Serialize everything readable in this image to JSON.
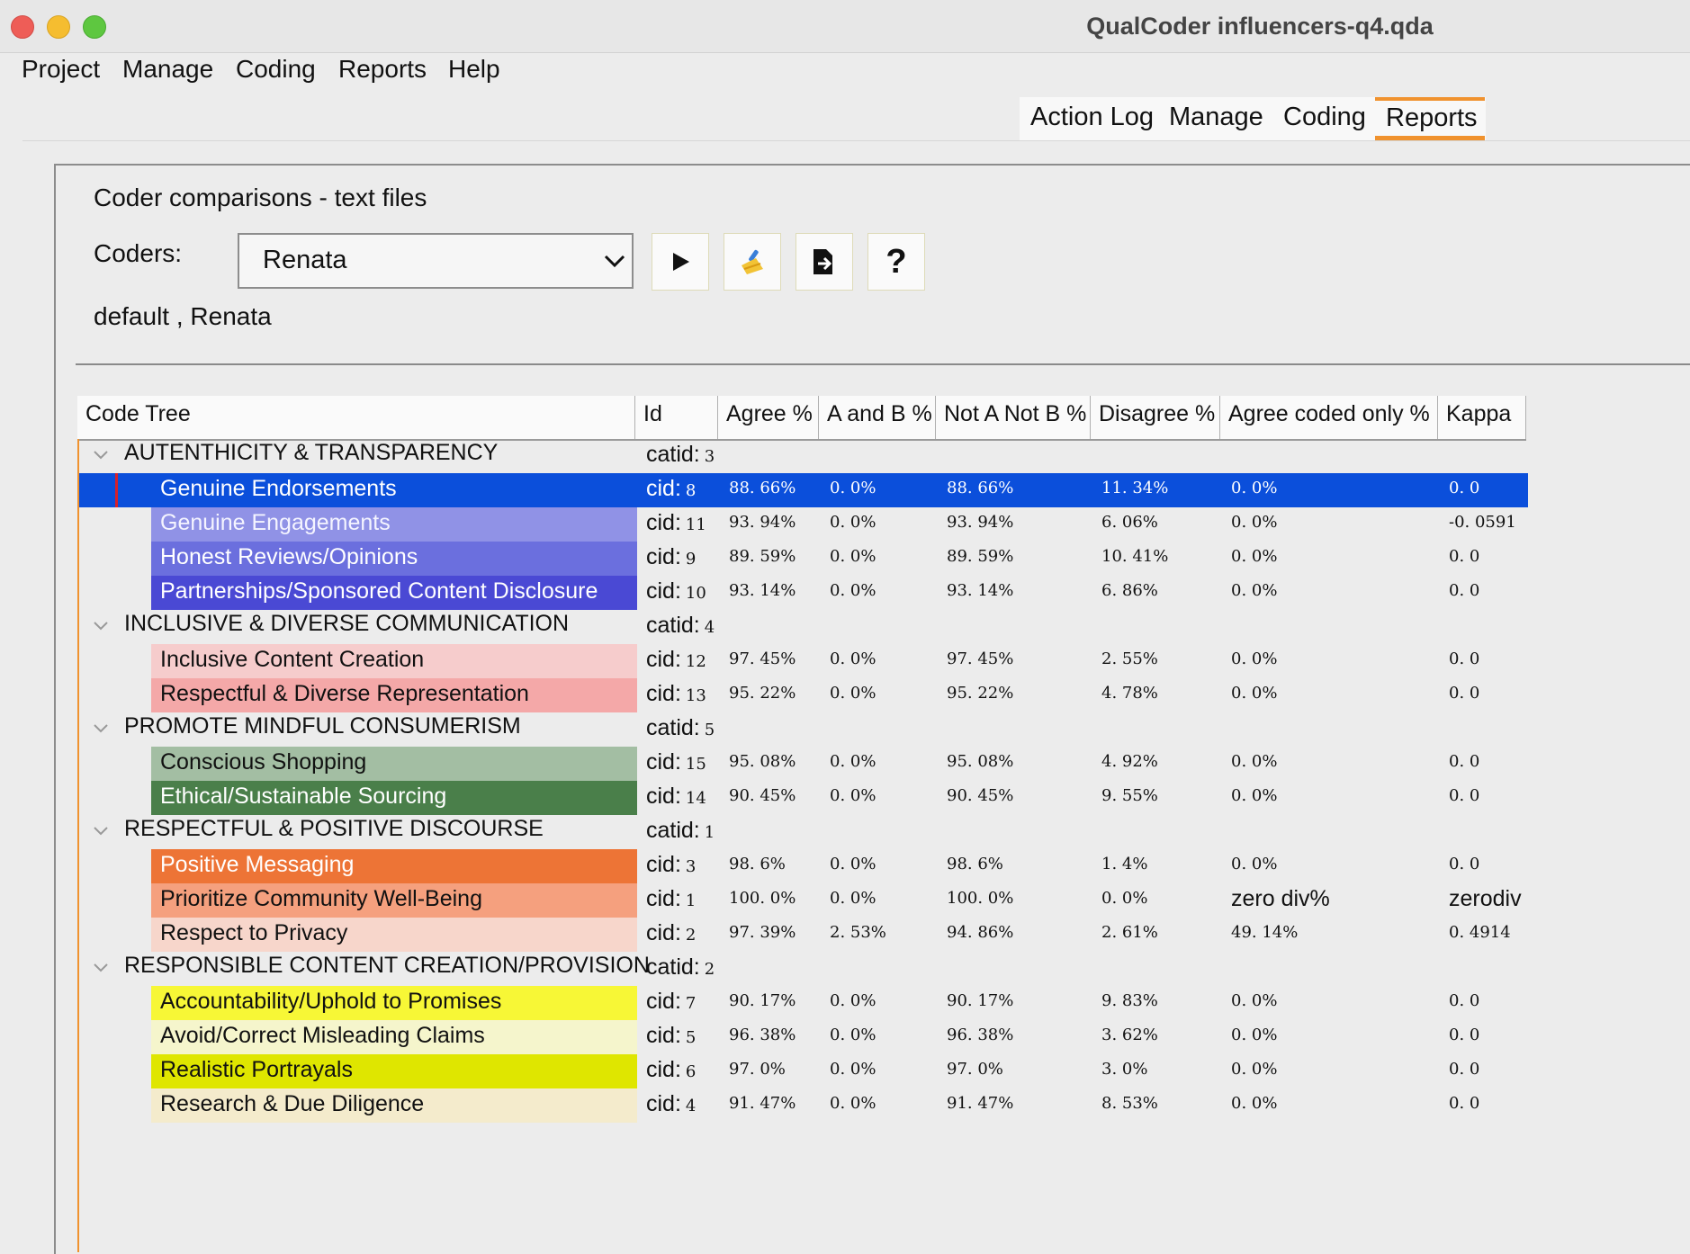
{
  "window": {
    "title": "QualCoder influencers-q4.qda"
  },
  "menubar": [
    "Project",
    "Manage",
    "Coding",
    "Reports",
    "Help"
  ],
  "tabs": [
    {
      "label": "Action Log",
      "active": false
    },
    {
      "label": "Manage",
      "active": false
    },
    {
      "label": "Coding",
      "active": false
    },
    {
      "label": "Reports",
      "active": true
    }
  ],
  "panel": {
    "title": "Coder comparisons - text files",
    "coders_label": "Coders:",
    "coder_selected": "Renata",
    "coders_list": "default , Renata",
    "toolbar_icons": [
      "run-icon",
      "clear-icon",
      "export-icon",
      "help-icon"
    ],
    "help_glyph": "?"
  },
  "table": {
    "headers": [
      "Code Tree",
      "Id",
      "Agree %",
      "A and B %",
      "Not A Not B %",
      "Disagree %",
      "Agree coded only %",
      "Kappa"
    ],
    "rows": [
      {
        "type": "category",
        "name": "AUTENTHICITY & TRANSPARENCY",
        "id_label": "catid:",
        "id": "3"
      },
      {
        "type": "code",
        "name": "Genuine Endorsements",
        "id_label": "cid:",
        "id": "8",
        "agree": "88. 66%",
        "ab": "0. 0%",
        "notab": "88. 66%",
        "disagree": "11. 34%",
        "agree_coded": "0. 0%",
        "kappa": "0. 0",
        "color": "#5861d4",
        "text_color": "#ffffff",
        "selected": true
      },
      {
        "type": "code",
        "name": "Genuine Engagements",
        "id_label": "cid:",
        "id": "11",
        "agree": "93. 94%",
        "ab": "0. 0%",
        "notab": "93. 94%",
        "disagree": "6. 06%",
        "agree_coded": "0. 0%",
        "kappa": "-0. 0591",
        "color": "#9092e6",
        "text_color": "#f4f4ff"
      },
      {
        "type": "code",
        "name": "Honest Reviews/Opinions",
        "id_label": "cid:",
        "id": "9",
        "agree": "89. 59%",
        "ab": "0. 0%",
        "notab": "89. 59%",
        "disagree": "10. 41%",
        "agree_coded": "0. 0%",
        "kappa": "0. 0",
        "color": "#6b6fde",
        "text_color": "#ffffff"
      },
      {
        "type": "code",
        "name": "Partnerships/Sponsored Content Disclosure",
        "id_label": "cid:",
        "id": "10",
        "agree": "93. 14%",
        "ab": "0. 0%",
        "notab": "93. 14%",
        "disagree": "6. 86%",
        "agree_coded": "0. 0%",
        "kappa": "0. 0",
        "color": "#4a49d4",
        "text_color": "#ffffff"
      },
      {
        "type": "category",
        "name": "INCLUSIVE & DIVERSE COMMUNICATION",
        "id_label": "catid:",
        "id": "4"
      },
      {
        "type": "code",
        "name": "Inclusive Content Creation",
        "id_label": "cid:",
        "id": "12",
        "agree": "97. 45%",
        "ab": "0. 0%",
        "notab": "97. 45%",
        "disagree": "2. 55%",
        "agree_coded": "0. 0%",
        "kappa": "0. 0",
        "color": "#f6cccc",
        "text_color": "#111111"
      },
      {
        "type": "code",
        "name": "Respectful & Diverse Representation",
        "id_label": "cid:",
        "id": "13",
        "agree": "95. 22%",
        "ab": "0. 0%",
        "notab": "95. 22%",
        "disagree": "4. 78%",
        "agree_coded": "0. 0%",
        "kappa": "0. 0",
        "color": "#f4a8a8",
        "text_color": "#111111"
      },
      {
        "type": "category",
        "name": "PROMOTE MINDFUL CONSUMERISM",
        "id_label": "catid:",
        "id": "5"
      },
      {
        "type": "code",
        "name": "Conscious Shopping",
        "id_label": "cid:",
        "id": "15",
        "agree": "95. 08%",
        "ab": "0. 0%",
        "notab": "95. 08%",
        "disagree": "4. 92%",
        "agree_coded": "0. 0%",
        "kappa": "0. 0",
        "color": "#a3bea3",
        "text_color": "#111111"
      },
      {
        "type": "code",
        "name": "Ethical/Sustainable Sourcing",
        "id_label": "cid:",
        "id": "14",
        "agree": "90. 45%",
        "ab": "0. 0%",
        "notab": "90. 45%",
        "disagree": "9. 55%",
        "agree_coded": "0. 0%",
        "kappa": "0. 0",
        "color": "#4a7f4a",
        "text_color": "#ffffff"
      },
      {
        "type": "category",
        "name": "RESPECTFUL & POSITIVE DISCOURSE",
        "id_label": "catid:",
        "id": "1"
      },
      {
        "type": "code",
        "name": "Positive Messaging",
        "id_label": "cid:",
        "id": "3",
        "agree": "98. 6%",
        "ab": "0. 0%",
        "notab": "98. 6%",
        "disagree": "1. 4%",
        "agree_coded": "0. 0%",
        "kappa": "0. 0",
        "color": "#ed7436",
        "text_color": "#ffffff"
      },
      {
        "type": "code",
        "name": "Prioritize Community Well-Being",
        "id_label": "cid:",
        "id": "1",
        "agree": "100. 0%",
        "ab": "0. 0%",
        "notab": "100. 0%",
        "disagree": "0. 0%",
        "agree_coded": "zero div%",
        "kappa": "zerodiv",
        "color": "#f5a07e",
        "text_color": "#111111"
      },
      {
        "type": "code",
        "name": "Respect to Privacy",
        "id_label": "cid:",
        "id": "2",
        "agree": "97. 39%",
        "ab": "2. 53%",
        "notab": "94. 86%",
        "disagree": "2. 61%",
        "agree_coded": "49. 14%",
        "kappa": "0. 4914",
        "color": "#f7d6cb",
        "text_color": "#111111"
      },
      {
        "type": "category",
        "name": "RESPONSIBLE CONTENT CREATION/PROVISION",
        "id_label": "catid:",
        "id": "2"
      },
      {
        "type": "code",
        "name": "Accountability/Uphold to Promises",
        "id_label": "cid:",
        "id": "7",
        "agree": "90. 17%",
        "ab": "0. 0%",
        "notab": "90. 17%",
        "disagree": "9. 83%",
        "agree_coded": "0. 0%",
        "kappa": "0. 0",
        "color": "#f7f736",
        "text_color": "#111111"
      },
      {
        "type": "code",
        "name": "Avoid/Correct Misleading Claims",
        "id_label": "cid:",
        "id": "5",
        "agree": "96. 38%",
        "ab": "0. 0%",
        "notab": "96. 38%",
        "disagree": "3. 62%",
        "agree_coded": "0. 0%",
        "kappa": "0. 0",
        "color": "#f5f5cc",
        "text_color": "#111111"
      },
      {
        "type": "code",
        "name": "Realistic Portrayals",
        "id_label": "cid:",
        "id": "6",
        "agree": "97. 0%",
        "ab": "0. 0%",
        "notab": "97. 0%",
        "disagree": "3. 0%",
        "agree_coded": "0. 0%",
        "kappa": "0. 0",
        "color": "#dfe600",
        "text_color": "#111111"
      },
      {
        "type": "code",
        "name": "Research & Due Diligence",
        "id_label": "cid:",
        "id": "4",
        "agree": "91. 47%",
        "ab": "0. 0%",
        "notab": "91. 47%",
        "disagree": "8. 53%",
        "agree_coded": "0. 0%",
        "kappa": "0. 0",
        "color": "#f4ebcc",
        "text_color": "#111111"
      }
    ]
  },
  "colors": {
    "accent": "#f0922e",
    "selection": "#0b4fdb"
  }
}
